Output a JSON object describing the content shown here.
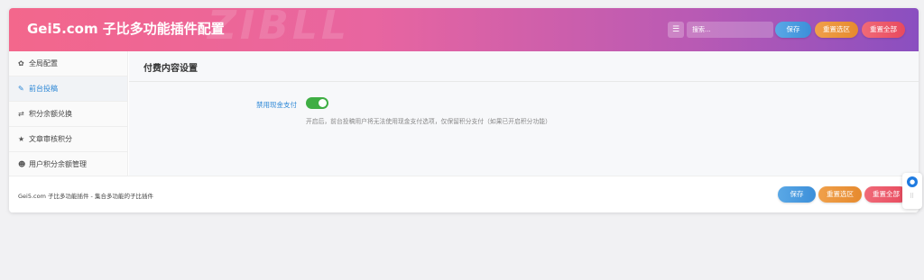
{
  "header": {
    "title": "Gei5.com 子比多功能插件配置",
    "watermark": "ZIBLL",
    "search_placeholder": "搜索...",
    "save_label": "保存",
    "reset_section_label": "重置选区",
    "reset_all_label": "重置全部"
  },
  "sidebar": {
    "items": [
      {
        "label": "全局配置",
        "icon": "gear-icon"
      },
      {
        "label": "前台投稿",
        "icon": "edit-icon"
      },
      {
        "label": "积分余额兑换",
        "icon": "exchange-icon"
      },
      {
        "label": "文章审核积分",
        "icon": "star-icon"
      },
      {
        "label": "用户积分余额管理",
        "icon": "users-icon"
      }
    ],
    "active_index": 1
  },
  "content": {
    "section_title": "付费内容设置",
    "option_label": "禁用现金支付",
    "toggle_on": true,
    "option_description": "开启后，前台投稿用户将无法使用现金支付选项，仅保留积分支付（如果已开启积分功能）"
  },
  "footer": {
    "text": "Gei5.com 子比多功能插件 - 集合多功能的子比插件",
    "save_label": "保存",
    "reset_section_label": "重置选区",
    "reset_all_label": "重置全部"
  },
  "colors": {
    "accent": "#2a86d6",
    "toggle_on": "#3fae44",
    "save": "#3c8fd9",
    "reset_section": "#e68a2e",
    "reset_all": "#e84a5e"
  }
}
